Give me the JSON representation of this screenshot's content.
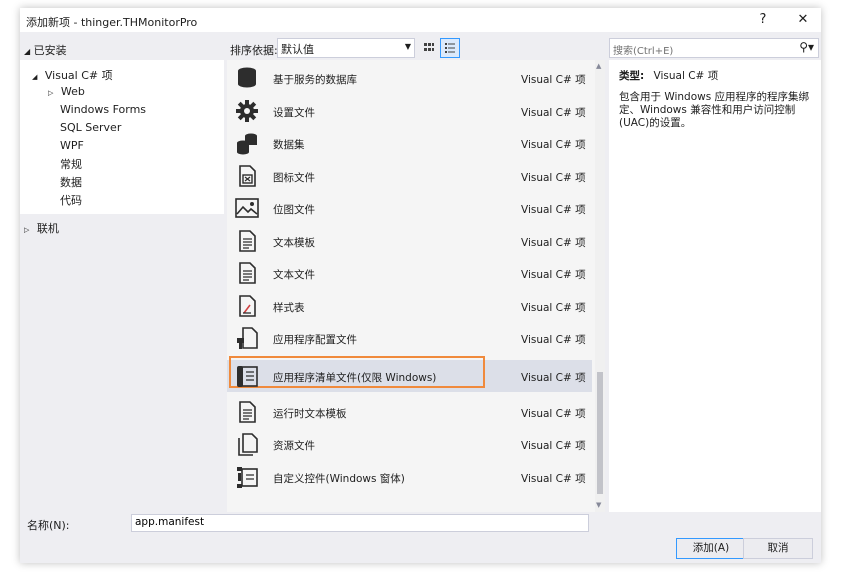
{
  "window": {
    "title": "添加新项 - thinger.THMonitorPro",
    "help_label": "?",
    "close_label": "✕"
  },
  "tree": {
    "installed_label": "已安装",
    "root_label": "Visual C# 项",
    "children": [
      "Web",
      "Windows Forms",
      "SQL Server",
      "WPF",
      "常规",
      "数据",
      "代码"
    ],
    "online_label": "联机"
  },
  "toolbar": {
    "sort_label": "排序依据:",
    "sort_value": "默认值"
  },
  "search": {
    "placeholder": "搜索(Ctrl+E)"
  },
  "items": [
    {
      "name": "基于服务的数据库",
      "type": "Visual C# 项",
      "icon": "database-icon"
    },
    {
      "name": "设置文件",
      "type": "Visual C# 项",
      "icon": "gear-icon"
    },
    {
      "name": "数据集",
      "type": "Visual C# 项",
      "icon": "dataset-icon"
    },
    {
      "name": "图标文件",
      "type": "Visual C# 项",
      "icon": "icon-file-icon"
    },
    {
      "name": "位图文件",
      "type": "Visual C# 项",
      "icon": "bitmap-icon"
    },
    {
      "name": "文本模板",
      "type": "Visual C# 项",
      "icon": "text-template-icon"
    },
    {
      "name": "文本文件",
      "type": "Visual C# 项",
      "icon": "text-file-icon"
    },
    {
      "name": "样式表",
      "type": "Visual C# 项",
      "icon": "stylesheet-icon"
    },
    {
      "name": "应用程序配置文件",
      "type": "Visual C# 项",
      "icon": "config-file-icon"
    },
    {
      "name": "应用程序清单文件(仅限 Windows)",
      "type": "Visual C# 项",
      "icon": "manifest-icon"
    },
    {
      "name": "运行时文本模板",
      "type": "Visual C# 项",
      "icon": "runtime-template-icon"
    },
    {
      "name": "资源文件",
      "type": "Visual C# 项",
      "icon": "resource-file-icon"
    },
    {
      "name": "自定义控件(Windows 窗体)",
      "type": "Visual C# 项",
      "icon": "custom-control-icon"
    }
  ],
  "details": {
    "type_label": "类型:",
    "type_value": "Visual C# 项",
    "description": "包含用于 Windows 应用程序的程序集绑定、Windows 兼容性和用户访问控制(UAC)的设置。"
  },
  "bottom": {
    "name_label": "名称(N):",
    "name_value": "app.manifest",
    "add_label": "添加(A)",
    "cancel_label": "取消"
  },
  "colors": {
    "dialog_bg": "#eeeef2",
    "selection_bg": "#dcdfe8",
    "highlight_border": "#f08a3c",
    "accent": "#3399ff"
  }
}
